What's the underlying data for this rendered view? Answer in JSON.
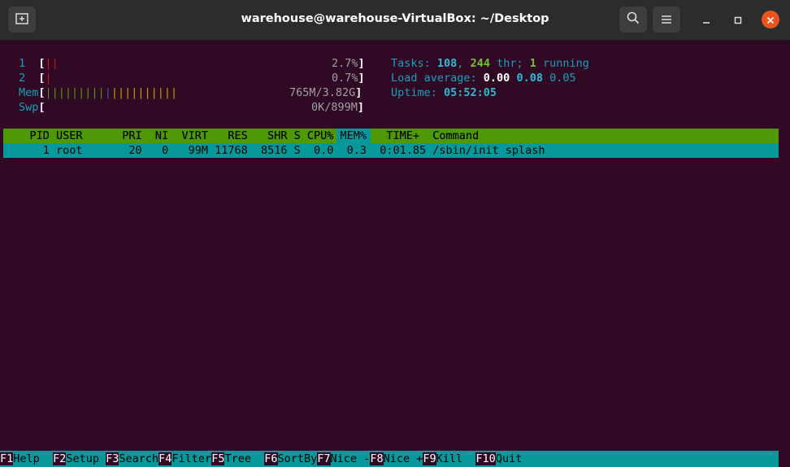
{
  "window": {
    "title": "warehouse@warehouse-VirtualBox: ~/Desktop"
  },
  "icons": {
    "new_tab": "new-tab-icon",
    "search": "search-icon",
    "menu": "hamburger-menu-icon",
    "minimize": "minimize-icon",
    "maximize": "maximize-icon",
    "close": "close-icon"
  },
  "colors": {
    "terminal_bg": "#300a24",
    "header_bar": "#4e9a06",
    "selected_row": "#06989a",
    "close_button": "#e95420"
  },
  "meters": {
    "cpu1": {
      "label": "1",
      "open": "[",
      "bars_red": "||",
      "value": "2.7%",
      "close": "]",
      "percent": 2.7
    },
    "cpu2": {
      "label": "2",
      "open": "[",
      "bars_red": "|",
      "value": "0.7%",
      "close": "]",
      "percent": 0.7
    },
    "mem": {
      "label": "Mem",
      "open": "[",
      "bars_green": "|||||||||",
      "bars_blue": "|",
      "bars_yellow": "||||||||||",
      "value": "765M/3.82G",
      "close": "]"
    },
    "swp": {
      "label": "Swp",
      "open": "[",
      "value": "0K/899M",
      "close": "]"
    }
  },
  "stats": {
    "tasks_label": "Tasks: ",
    "tasks": "108",
    "thr_sep": ", ",
    "threads": "244",
    "thr_label": " thr; ",
    "running": "1",
    "running_label": " running",
    "load_label": "Load average: ",
    "load1": "0.00",
    "load5": "0.08",
    "load15": "0.05",
    "uptime_label": "Uptime: ",
    "uptime": "05:52:05"
  },
  "table": {
    "header": "    PID USER      PRI  NI  VIRT   RES   SHR S CPU% MEM%   TIME+  Command",
    "rows": [
      {
        "line": "      1 root       20   0   99M 11768  8516 S  0.0  0.3  0:01.85 /sbin/init splash"
      }
    ]
  },
  "footer": [
    {
      "key": "F1",
      "label": "Help  "
    },
    {
      "key": "F2",
      "label": "Setup "
    },
    {
      "key": "F3",
      "label": "Search"
    },
    {
      "key": "F4",
      "label": "Filter"
    },
    {
      "key": "F5",
      "label": "Tree  "
    },
    {
      "key": "F6",
      "label": "SortBy"
    },
    {
      "key": "F7",
      "label": "Nice -"
    },
    {
      "key": "F8",
      "label": "Nice +"
    },
    {
      "key": "F9",
      "label": "Kill  "
    },
    {
      "key": "F10",
      "label": "Quit"
    }
  ]
}
